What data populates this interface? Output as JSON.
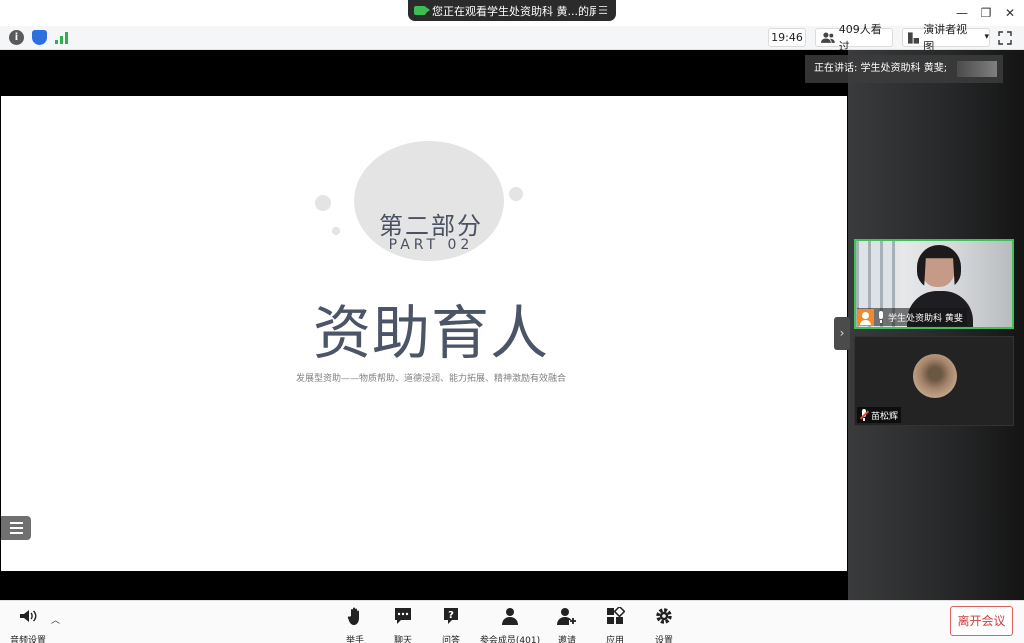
{
  "titlebar": {
    "share_status": "您正在观看学生处资助科 黄...的屏幕",
    "menu_icon": "menu-icon",
    "minimize": "—",
    "restore": "❐",
    "close": "✕"
  },
  "toolbar": {
    "time": "19:46",
    "viewers": "409人看过",
    "view_mode": "演讲者视图",
    "view_mode_arrow": "▾"
  },
  "speaking": {
    "text": "正在讲话: 学生处资助科 黄斐;"
  },
  "slide": {
    "heading": "第二部分",
    "part": "PART 02",
    "title": "资助育人",
    "subtitle": "发展型资助——物质帮助、道德浸润、能力拓展、精神激励有效融合"
  },
  "participants": [
    {
      "name": "学生处资助科 黄斐",
      "speaking": true
    },
    {
      "name": "苗松辉",
      "muted": true
    }
  ],
  "bottom_bar": {
    "audio_settings": "音频设置",
    "raise_hand": "举手",
    "chat": "聊天",
    "qa": "问答",
    "participants": "参会成员(401)",
    "invite": "邀请",
    "apps": "应用",
    "settings": "设置",
    "leave": "离开会议"
  },
  "colors": {
    "active_green": "#3ec257",
    "leave_red": "#d23b3b",
    "slide_text": "#4c5467"
  }
}
